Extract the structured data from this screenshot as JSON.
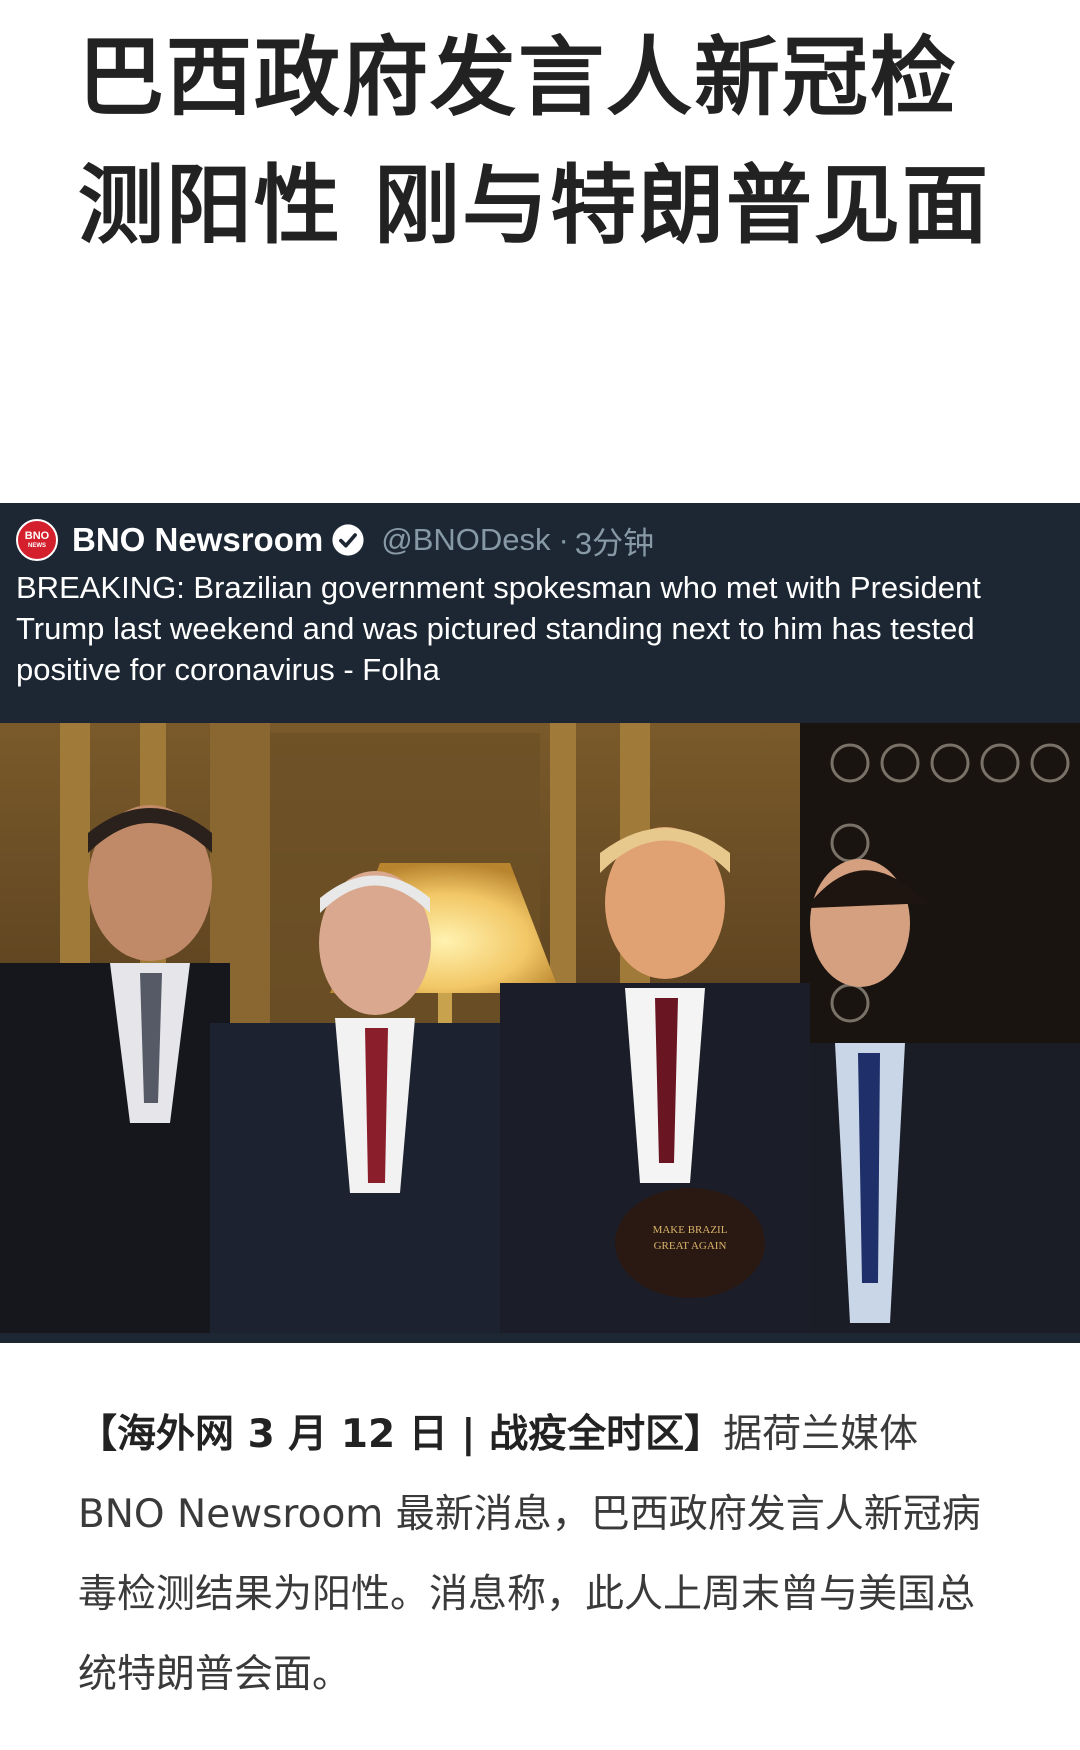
{
  "article": {
    "headline": "巴西政府发言人新冠检测阳性 刚与特朗普见面",
    "lead": "【海外网 3 月 12 日 | 战疫全时区】",
    "body": "据荷兰媒体 BNO Newsroom 最新消息，巴西政府发言人新冠病毒检测结果为阳性。消息称，此人上周末曾与美国总统特朗普会面。"
  },
  "tweet": {
    "logo_line1": "BNO",
    "logo_line2": "NEWS",
    "name": "BNO Newsroom",
    "handle": "@BNODesk",
    "separator": "·",
    "time": "3分钟",
    "text": "BREAKING: Brazilian government spokesman who met with President Trump last weekend and was pictured standing next to him has tested positive for coronavirus - Folha",
    "photo": {
      "hat_text_line1": "MAKE BRAZIL",
      "hat_text_line2": "GREAT AGAIN"
    }
  },
  "colors": {
    "tweet_bg": "#1c2733",
    "logo_red": "#d4202c",
    "verified": "#ffffff",
    "handle_gray": "#8899a6",
    "headline": "#222222",
    "body_text": "#3a3a3a"
  }
}
